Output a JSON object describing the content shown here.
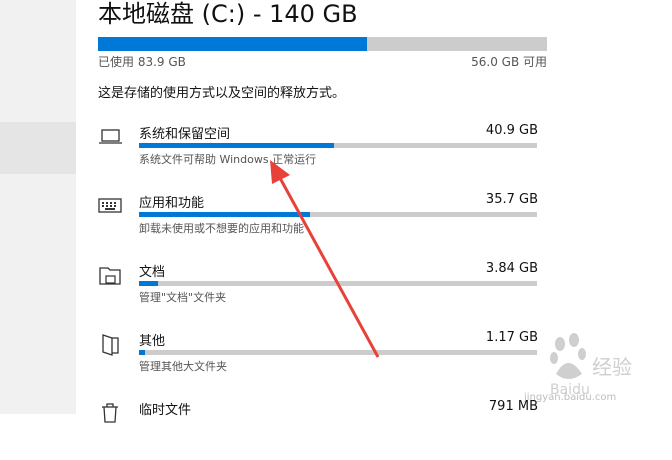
{
  "drive": {
    "title": "本地磁盘 (C:) - 140 GB",
    "used_label": "已使用 83.9 GB",
    "free_label": "56.0 GB 可用",
    "used_fraction": 0.599,
    "description": "这是存储的使用方式以及空间的释放方式。"
  },
  "categories": [
    {
      "name": "系统和保留空间",
      "size": "40.9 GB",
      "sub": "系统文件可帮助 Windows 正常运行",
      "fraction": 0.49,
      "icon": "laptop-icon"
    },
    {
      "name": "应用和功能",
      "size": "35.7 GB",
      "sub": "卸载未使用或不想要的应用和功能",
      "fraction": 0.43,
      "icon": "keyboard-icon"
    },
    {
      "name": "文档",
      "size": "3.84 GB",
      "sub": "管理\"文档\"文件夹",
      "fraction": 0.047,
      "icon": "documents-folder-icon"
    },
    {
      "name": "其他",
      "size": "1.17 GB",
      "sub": "管理其他大文件夹",
      "fraction": 0.015,
      "icon": "other-folder-icon"
    },
    {
      "name": "临时文件",
      "size": "791 MB",
      "sub": "",
      "fraction": 0.01,
      "icon": "trash-icon"
    }
  ],
  "watermark": {
    "logo_text": "Baidu 经验",
    "url": "jingyan.baidu.com"
  },
  "colors": {
    "accent": "#0078d7",
    "track": "#cccccc",
    "arrow": "#e8413a"
  }
}
